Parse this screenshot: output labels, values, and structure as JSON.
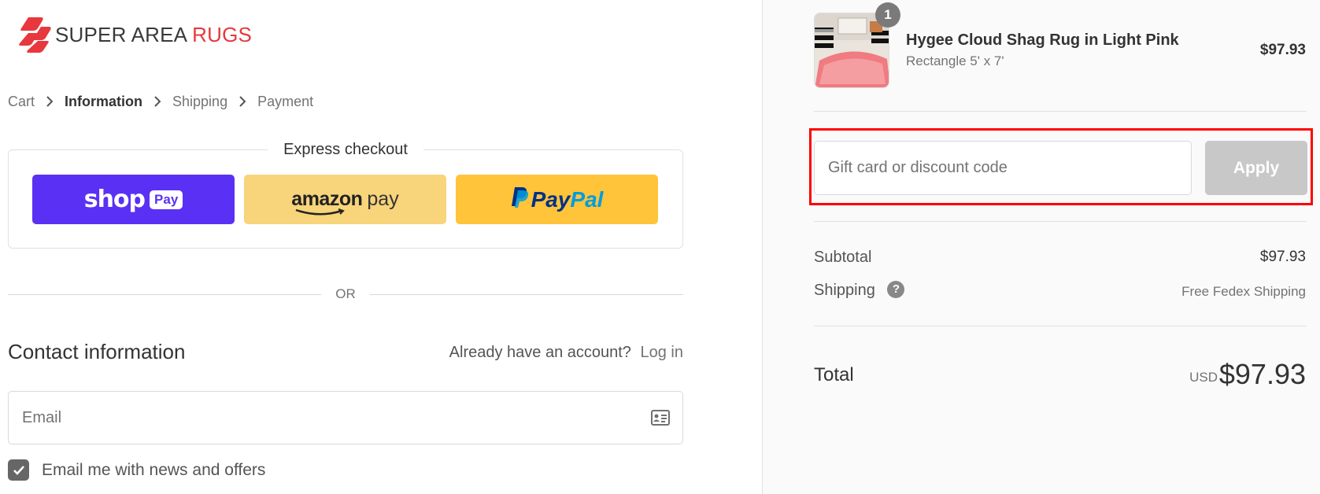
{
  "brand": {
    "name_main": "SUPER AREA",
    "name_accent": "RUGS",
    "colors": {
      "accent": "#e8383d",
      "text": "#3a3a3a"
    }
  },
  "breadcrumb": {
    "items": [
      {
        "label": "Cart",
        "state": "link"
      },
      {
        "label": "Information",
        "state": "current"
      },
      {
        "label": "Shipping",
        "state": "upcoming"
      },
      {
        "label": "Payment",
        "state": "upcoming"
      }
    ],
    "separator_icon": "chevron-right-icon"
  },
  "express_checkout": {
    "title": "Express checkout",
    "shop_pay": {
      "word": "shop",
      "pill": "Pay",
      "color": "#5a31f4"
    },
    "amazon_pay": {
      "word": "amazon",
      "suffix": "pay",
      "color": "#f8d47a"
    },
    "paypal": {
      "part1": "Pay",
      "part2": "Pal",
      "color": "#ffc439"
    }
  },
  "divider_or": "OR",
  "contact": {
    "title": "Contact information",
    "account_prompt": "Already have an account?",
    "login_link": "Log in",
    "email_placeholder": "Email",
    "email_icon": "contact-card-icon",
    "newsletter_label": "Email me with news and offers",
    "newsletter_checked": true
  },
  "order_summary": {
    "product": {
      "name": "Hygee Cloud Shag Rug in Light Pink",
      "variant": "Rectangle 5' x 7'",
      "price": "$97.93",
      "quantity": "1"
    },
    "discount": {
      "placeholder": "Gift card or discount code",
      "apply_label": "Apply"
    },
    "subtotal_label": "Subtotal",
    "subtotal_value": "$97.93",
    "shipping_label": "Shipping",
    "shipping_help_icon": "question-icon",
    "shipping_value": "Free Fedex Shipping",
    "total_label": "Total",
    "total_currency": "USD",
    "total_value": "$97.93"
  },
  "highlight_color": "#ff0000"
}
